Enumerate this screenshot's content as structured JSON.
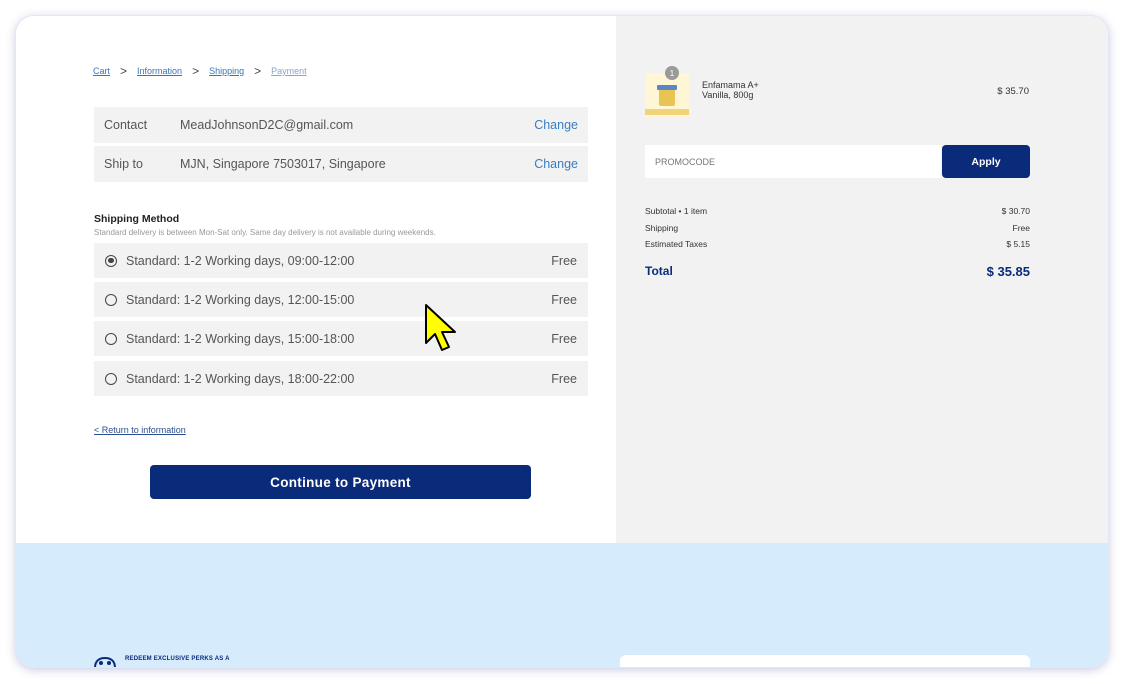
{
  "breadcrumb": {
    "items": [
      "Cart",
      "Information",
      "Shipping",
      "Payment"
    ],
    "separator": ">"
  },
  "contact": {
    "label": "Contact",
    "value": "MeadJohnsonD2C@gmail.com",
    "change": "Change"
  },
  "ship_to": {
    "label": "Ship to",
    "value": "MJN, Singapore 7503017, Singapore",
    "change": "Change"
  },
  "shipping_method": {
    "title": "Shipping Method",
    "subtitle": "Standard delivery is between Mon-Sat only. Same day delivery is not available during weekends.",
    "options": [
      {
        "label": "Standard: 1-2 Working days, 09:00-12:00",
        "price": "Free",
        "selected": true
      },
      {
        "label": "Standard: 1-2 Working days, 12:00-15:00",
        "price": "Free",
        "selected": false
      },
      {
        "label": "Standard: 1-2 Working days, 15:00-18:00",
        "price": "Free",
        "selected": false
      },
      {
        "label": "Standard: 1-2 Working days, 18:00-22:00",
        "price": "Free",
        "selected": false
      }
    ]
  },
  "return_link": "< Return to information",
  "continue_button": "Continue to Payment",
  "order": {
    "product": {
      "name_line1": "Enfamama A+",
      "name_line2": "Vanilla, 800g",
      "price": "$ 35.70",
      "quantity": "1"
    },
    "promo": {
      "placeholder": "PROMOCODE",
      "value": "PROMOCODE",
      "apply_label": "Apply"
    },
    "summary": {
      "subtotal_label": "Subtotal • 1 item",
      "subtotal_value": "$ 30.70",
      "shipping_label": "Shipping",
      "shipping_value": "Free",
      "taxes_label": "Estimated Taxes",
      "taxes_value": "$ 5.15",
      "total_label": "Total",
      "total_value": "$ 35.85"
    }
  },
  "footer": {
    "perks_text": "REDEEM EXCLUSIVE PERKS AS A"
  },
  "colors": {
    "primary": "#0a2a7a",
    "link": "#3a7dc0",
    "panel": "#f2f2f2",
    "footer_bg": "#d6ebfb",
    "cursor": "#ffff00"
  }
}
